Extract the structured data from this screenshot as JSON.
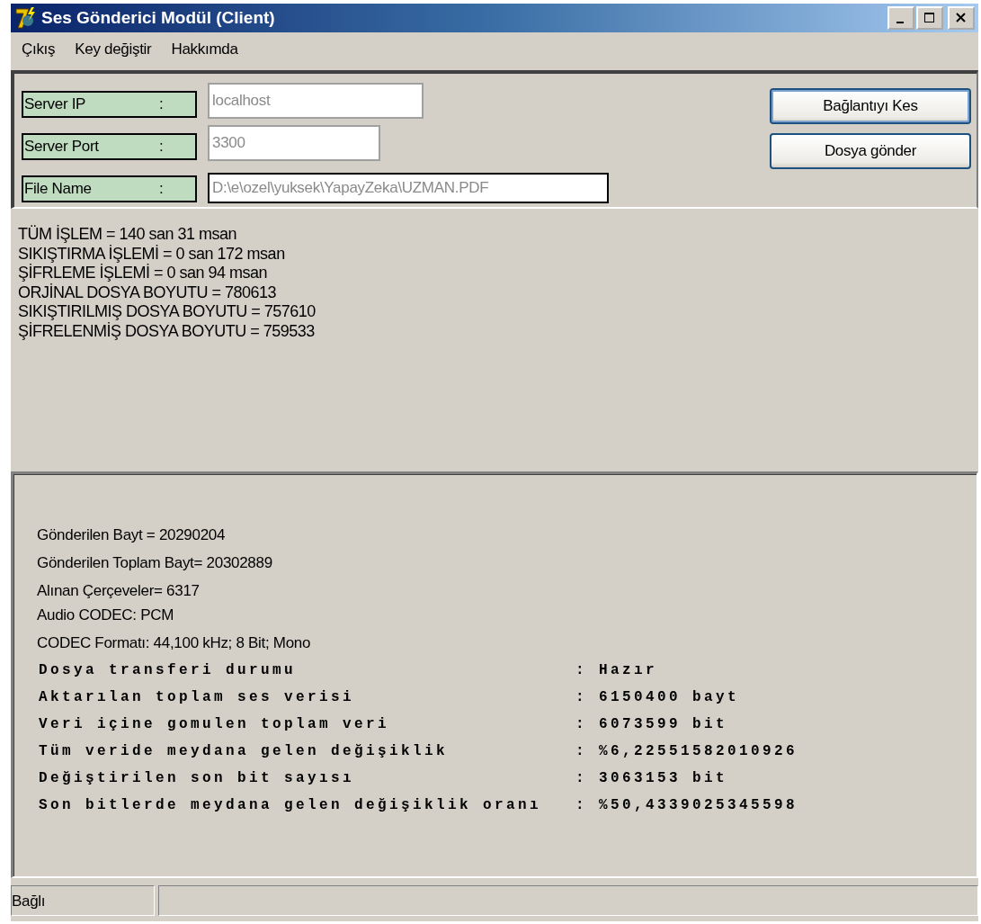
{
  "window": {
    "title": "Ses Gönderici Modül (Client)"
  },
  "menu": [
    "Çıkış",
    "Key değiştir",
    "Hakkımda"
  ],
  "fields": [
    {
      "label": "Server IP",
      "sep": ":",
      "value": "localhost"
    },
    {
      "label": "Server Port",
      "sep": ":",
      "value": "3300"
    },
    {
      "label": "File Name",
      "sep": ":",
      "value": "D:\\e\\ozel\\yuksek\\YapayZeka\\UZMAN.PDF"
    }
  ],
  "buttons": [
    {
      "label": "Bağlantıyı Kes",
      "default": true
    },
    {
      "label": "Dosya gönder",
      "default": false
    }
  ],
  "timings": [
    "TÜM İŞLEM = 140 san 31 msan",
    "SIKIŞTIRMA İŞLEMİ = 0 san 172 msan",
    "ŞİFRLEME İŞLEMİ = 0 san 94 msan",
    "ORJİNAL DOSYA BOYUTU = 780613",
    "SIKIŞTIRILMIŞ DOSYA BOYUTU = 757610",
    "ŞİFRELENMİŞ DOSYA BOYUTU = 759533"
  ],
  "transfer_info": [
    "Gönderilen Bayt = 20290204",
    "Gönderilen Toplam Bayt= 20302889",
    "Alınan Çerçeveler= 6317",
    "Audio CODEC: PCM",
    "CODEC Formatı: 44,100 kHz; 8 Bit; Mono"
  ],
  "report": [
    {
      "label": "Dosya transferi durumu",
      "value": ": Hazır"
    },
    {
      "label": "Aktarılan toplam ses verisi",
      "value": ": 6150400 bayt"
    },
    {
      "label": "Veri içine gomulen toplam veri",
      "value": ": 6073599 bit"
    },
    {
      "label": "Tüm veride meydana gelen değişiklik",
      "value": ": %6,22551582010926"
    },
    {
      "label": "Değiştirilen son bit sayısı",
      "value": ": 3063153 bit"
    },
    {
      "label": "Son bitlerde meydana gelen değişiklik oranı",
      "value": ": %50,4339025345598"
    }
  ],
  "status_bar": {
    "text": "Bağlı"
  }
}
